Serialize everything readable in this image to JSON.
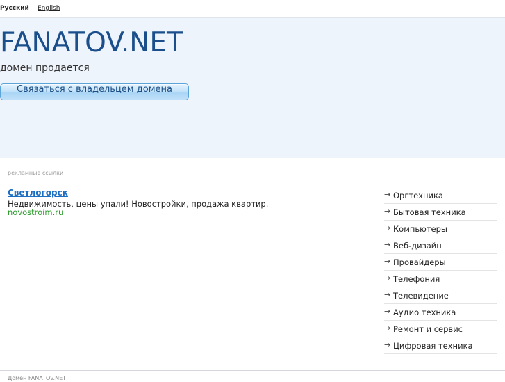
{
  "languages": {
    "ru": "Русский",
    "en": "English"
  },
  "hero": {
    "title": "FANATOV.NET",
    "subtitle": "домен продается",
    "contact_button": "Связаться с владельцем домена"
  },
  "ads": {
    "label": "рекламные ссылки",
    "items": [
      {
        "title": "Светлогорск",
        "description": "Недвижимость, цены упали! Новостройки, продажа квартир.",
        "url": "novostroim.ru"
      }
    ]
  },
  "categories": {
    "arrow": "→",
    "items": [
      "Оргтехника",
      "Бытовая техника",
      "Компьютеры",
      "Веб-дизайн",
      "Провайдеры",
      "Телефония",
      "Телевидение",
      "Аудио техника",
      "Ремонт и сервис",
      "Цифровая техника"
    ]
  },
  "footer": {
    "text": "Домен FANATOV.NET"
  },
  "colors": {
    "title": "#1a4f8b",
    "hero_background": "#eef4fc",
    "link": "#1b6ec2",
    "ad_url": "#2b9a2b"
  }
}
